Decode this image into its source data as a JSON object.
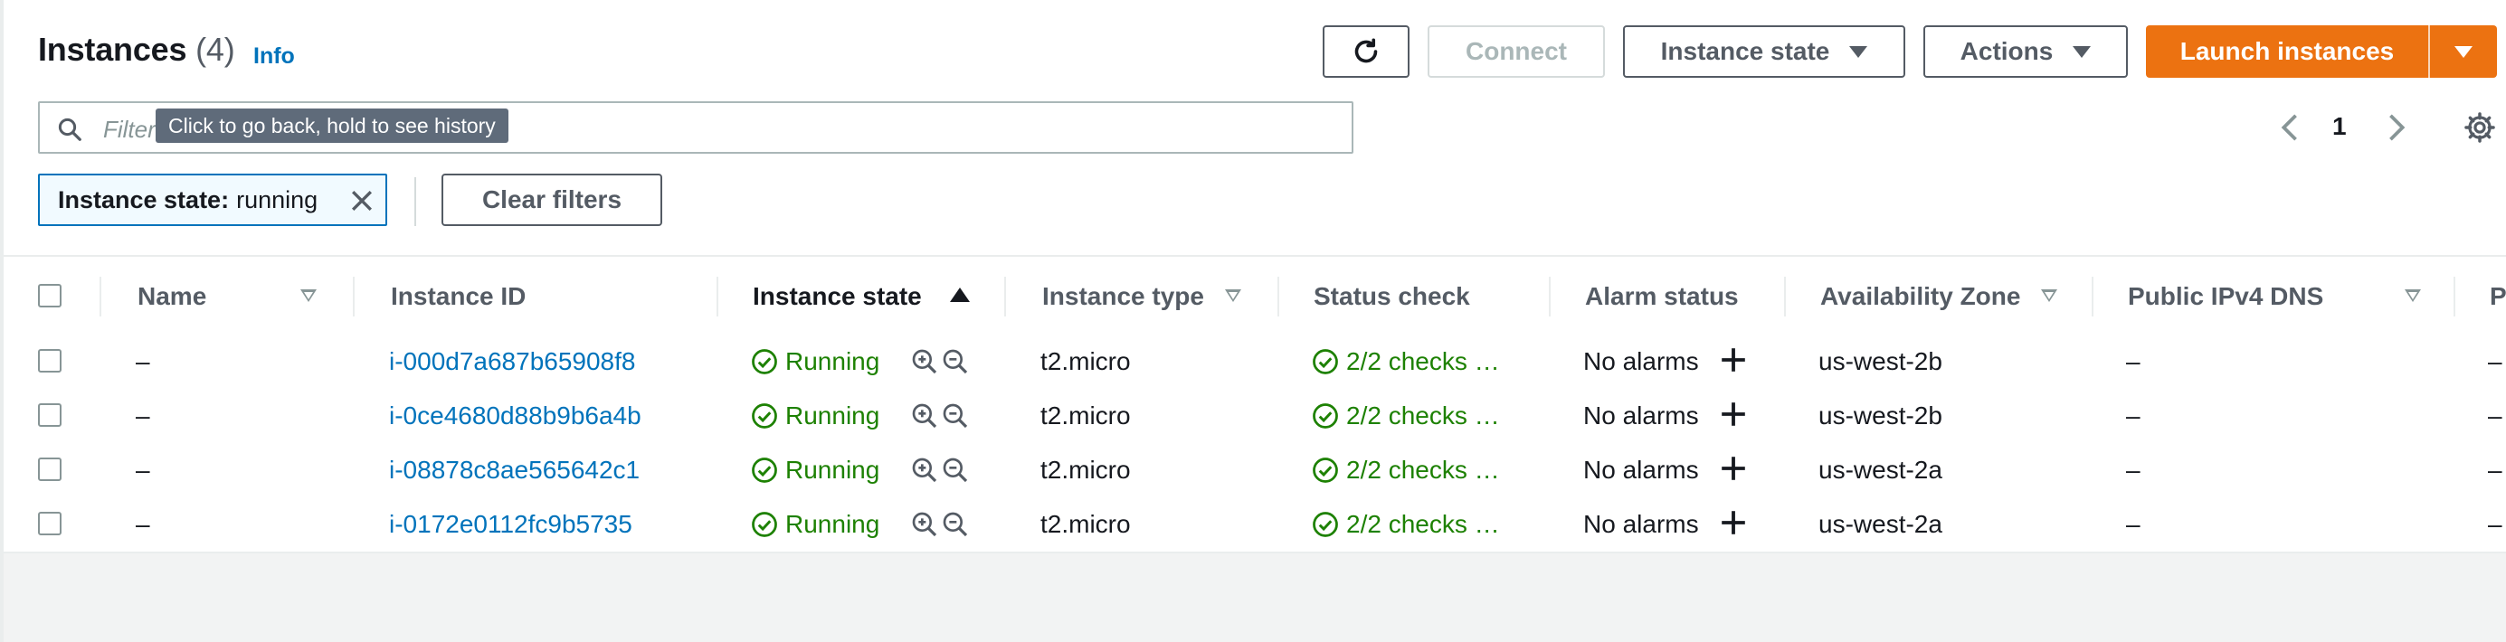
{
  "header": {
    "title": "Instances",
    "count": "(4)",
    "info": "Info",
    "connect": "Connect",
    "instance_state": "Instance state",
    "actions": "Actions",
    "launch": "Launch instances"
  },
  "search": {
    "placeholder": "Filter",
    "tooltip": "Click to go back, hold to see history"
  },
  "pagination": {
    "page": "1"
  },
  "filter": {
    "chip_key": "Instance state:",
    "chip_value": "running",
    "clear": "Clear filters"
  },
  "table": {
    "columns": [
      "Name",
      "Instance ID",
      "Instance state",
      "Instance type",
      "Status check",
      "Alarm status",
      "Availability Zone",
      "Public IPv4 DNS",
      "P"
    ],
    "rows": [
      {
        "name": "–",
        "id": "i-000d7a687b65908f8",
        "state": "Running",
        "type": "t2.micro",
        "check": "2/2 checks …",
        "alarm": "No alarms",
        "az": "us-west-2b",
        "dns": "–",
        "extra": "–"
      },
      {
        "name": "–",
        "id": "i-0ce4680d88b9b6a4b",
        "state": "Running",
        "type": "t2.micro",
        "check": "2/2 checks …",
        "alarm": "No alarms",
        "az": "us-west-2b",
        "dns": "–",
        "extra": "–"
      },
      {
        "name": "–",
        "id": "i-08878c8ae565642c1",
        "state": "Running",
        "type": "t2.micro",
        "check": "2/2 checks …",
        "alarm": "No alarms",
        "az": "us-west-2a",
        "dns": "–",
        "extra": "–"
      },
      {
        "name": "–",
        "id": "i-0172e0112fc9b5735",
        "state": "Running",
        "type": "t2.micro",
        "check": "2/2 checks …",
        "alarm": "No alarms",
        "az": "us-west-2a",
        "dns": "–",
        "extra": "–"
      }
    ]
  },
  "icons": {
    "refresh": "refresh-icon",
    "search": "search-icon",
    "settings": "gear-icon",
    "running": "check-circle-icon",
    "zoom_in": "zoom-in-icon",
    "zoom_out": "zoom-out-icon",
    "add_alarm": "plus-icon"
  },
  "colors": {
    "accent": "#ec7211",
    "link": "#0073bb",
    "success": "#1d8102",
    "chip_border": "#0073bb"
  }
}
